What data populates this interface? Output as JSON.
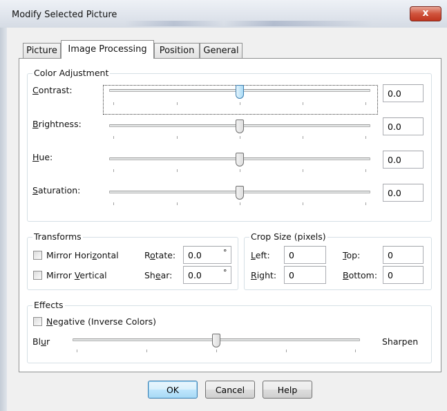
{
  "window": {
    "title": "Modify Selected Picture",
    "close_glyph": "x"
  },
  "tabs": [
    {
      "label": "Picture",
      "active": false
    },
    {
      "label": "Image Processing",
      "active": true
    },
    {
      "label": "Position",
      "active": false
    },
    {
      "label": "General",
      "active": false
    }
  ],
  "color_adjustment": {
    "title": "Color Adjustment",
    "rows": [
      {
        "label": "Contrast:",
        "value": "0.0",
        "slider_level": 0.5
      },
      {
        "label": "Brightness:",
        "value": "0.0",
        "slider_level": 0.5
      },
      {
        "label": "Hue:",
        "value": "0.0",
        "slider_level": 0.5
      },
      {
        "label": "Saturation:",
        "value": "0.0",
        "slider_level": 0.5
      }
    ]
  },
  "transforms": {
    "title": "Transforms",
    "mirror_horizontal": {
      "label": "Mirror Horizontal",
      "checked": false
    },
    "mirror_vertical": {
      "label": "Mirror Vertical",
      "checked": false
    },
    "rotate": {
      "label": "Rotate:",
      "value": "0.0",
      "unit": "°"
    },
    "shear": {
      "label": "Shear:",
      "value": "0.0",
      "unit": "°"
    }
  },
  "crop": {
    "title": "Crop Size (pixels)",
    "left": {
      "label": "Left:",
      "value": "0"
    },
    "top": {
      "label": "Top:",
      "value": "0"
    },
    "right": {
      "label": "Right:",
      "value": "0"
    },
    "bottom": {
      "label": "Bottom:",
      "value": "0"
    }
  },
  "effects": {
    "title": "Effects",
    "negative": {
      "label": "Negative (Inverse Colors)",
      "checked": false
    },
    "blur_label": "Blur",
    "sharpen_label": "Sharpen",
    "slider_level": 0.5
  },
  "buttons": {
    "ok": "OK",
    "cancel": "Cancel",
    "help": "Help"
  },
  "colors": {
    "close_button": "#c0351e",
    "focused_thumb": "#a9dbf6",
    "default_button_border": "#3c7fb1"
  }
}
